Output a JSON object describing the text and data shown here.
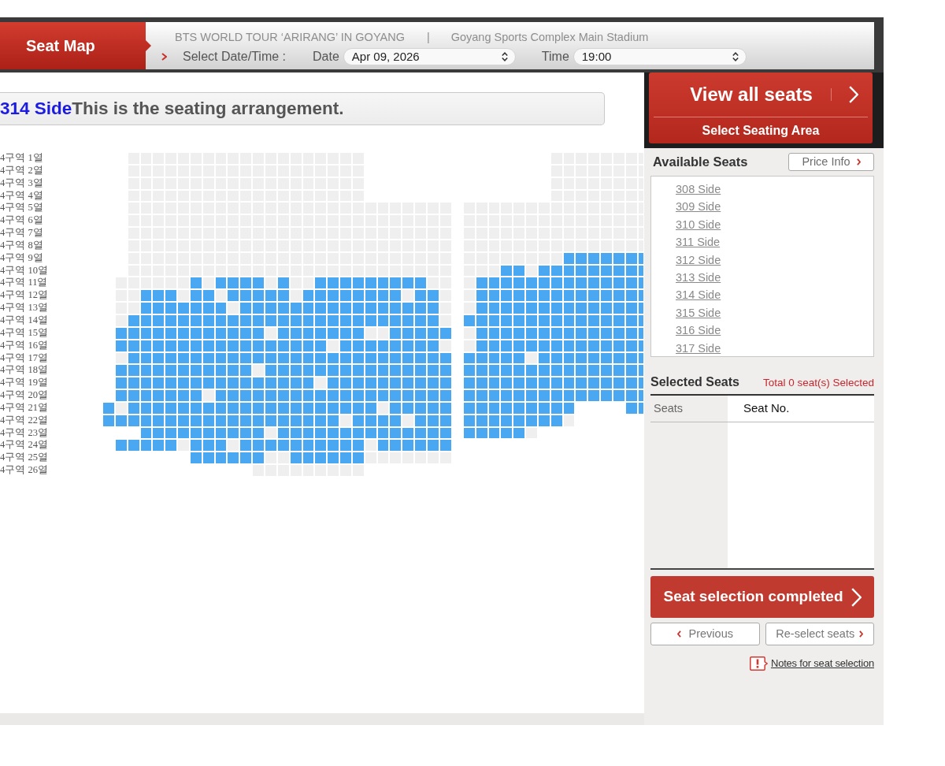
{
  "header": {
    "title": "Seat Map",
    "event": "BTS WORLD TOUR ‘ARIRANG’ IN GOYANG",
    "separator": "|",
    "venue": "Goyang Sports Complex Main Stadium",
    "select_label": "Select Date/Time :",
    "date": {
      "label": "Date",
      "value": "Apr 09, 2026"
    },
    "time": {
      "label": "Time",
      "value": "19:00"
    }
  },
  "seat_map": {
    "area": "314 Side",
    "caption": "This is the seating arrangement.",
    "rows": [
      {
        "label": "4구역 1열",
        "left": [
          {
            "kind": "gap"
          },
          {
            "kind": "gap"
          },
          false,
          false,
          false,
          false,
          false,
          false,
          false,
          false,
          false,
          false,
          false,
          false,
          false,
          false,
          false,
          false,
          false,
          false,
          false
        ],
        "right": [
          {
            "kind": "gap"
          },
          {
            "kind": "gap"
          },
          {
            "kind": "gap"
          },
          {
            "kind": "gap"
          },
          {
            "kind": "gap"
          },
          {
            "kind": "gap"
          },
          {
            "kind": "gap"
          },
          false,
          false,
          false,
          false,
          false,
          false,
          false,
          false
        ]
      },
      {
        "label": "4구역 2열",
        "left": [
          {
            "kind": "gap"
          },
          {
            "kind": "gap"
          },
          false,
          false,
          false,
          false,
          false,
          false,
          false,
          false,
          false,
          false,
          false,
          false,
          false,
          false,
          false,
          false,
          false,
          false,
          false
        ],
        "right": [
          {
            "kind": "gap"
          },
          {
            "kind": "gap"
          },
          {
            "kind": "gap"
          },
          {
            "kind": "gap"
          },
          {
            "kind": "gap"
          },
          {
            "kind": "gap"
          },
          {
            "kind": "gap"
          },
          false,
          false,
          false,
          false,
          false,
          false,
          false,
          false
        ]
      },
      {
        "label": "4구역 3열",
        "left": [
          {
            "kind": "gap"
          },
          {
            "kind": "gap"
          },
          false,
          false,
          false,
          false,
          false,
          false,
          false,
          false,
          false,
          false,
          false,
          false,
          false,
          false,
          false,
          false,
          false,
          false,
          false
        ],
        "right": [
          {
            "kind": "gap"
          },
          {
            "kind": "gap"
          },
          {
            "kind": "gap"
          },
          {
            "kind": "gap"
          },
          {
            "kind": "gap"
          },
          {
            "kind": "gap"
          },
          {
            "kind": "gap"
          },
          false,
          false,
          false,
          false,
          false,
          false,
          false,
          false
        ]
      },
      {
        "label": "4구역 4열",
        "left": [
          {
            "kind": "gap"
          },
          {
            "kind": "gap"
          },
          false,
          false,
          false,
          false,
          false,
          false,
          false,
          false,
          false,
          false,
          false,
          false,
          false,
          false,
          false,
          false,
          false,
          false,
          false
        ],
        "right": [
          {
            "kind": "gap"
          },
          {
            "kind": "gap"
          },
          {
            "kind": "gap"
          },
          {
            "kind": "gap"
          },
          {
            "kind": "gap"
          },
          {
            "kind": "gap"
          },
          {
            "kind": "gap"
          },
          false,
          false,
          false,
          false,
          false,
          false,
          false,
          false
        ]
      },
      {
        "label": "4구역 5열",
        "left": [
          {
            "kind": "gap"
          },
          {
            "kind": "gap"
          },
          false,
          false,
          false,
          false,
          false,
          false,
          false,
          false,
          false,
          false,
          false,
          false,
          false,
          false,
          false,
          false,
          false,
          false,
          false,
          false,
          false,
          false,
          false,
          false,
          false,
          false
        ],
        "right": [
          false,
          false,
          false,
          false,
          false,
          false,
          false,
          false,
          false,
          false,
          false,
          false,
          false,
          false,
          false
        ]
      },
      {
        "label": "4구역 6열",
        "left": [
          {
            "kind": "gap"
          },
          {
            "kind": "gap"
          },
          false,
          false,
          false,
          false,
          false,
          false,
          false,
          false,
          false,
          false,
          false,
          false,
          false,
          false,
          false,
          false,
          false,
          false,
          false,
          false,
          false,
          false,
          false,
          false,
          false,
          false
        ],
        "right": [
          false,
          false,
          false,
          false,
          false,
          false,
          false,
          false,
          false,
          false,
          false,
          false,
          false,
          false,
          false
        ]
      },
      {
        "label": "4구역 7열",
        "left": [
          {
            "kind": "gap"
          },
          {
            "kind": "gap"
          },
          false,
          false,
          false,
          false,
          false,
          false,
          false,
          false,
          false,
          false,
          false,
          false,
          false,
          false,
          false,
          false,
          false,
          false,
          false,
          false,
          false,
          false,
          false,
          false,
          false,
          false
        ],
        "right": [
          false,
          false,
          false,
          false,
          false,
          false,
          false,
          false,
          false,
          false,
          false,
          false,
          false,
          false,
          false
        ]
      },
      {
        "label": "4구역 8열",
        "left": [
          {
            "kind": "gap"
          },
          {
            "kind": "gap"
          },
          false,
          false,
          false,
          false,
          false,
          false,
          false,
          false,
          false,
          false,
          false,
          false,
          false,
          false,
          false,
          false,
          false,
          false,
          false,
          false,
          false,
          false,
          false,
          false,
          false,
          false
        ],
        "right": [
          false,
          false,
          false,
          false,
          false,
          false,
          false,
          false,
          false,
          false,
          false,
          false,
          false,
          false,
          false
        ]
      },
      {
        "label": "4구역 9열",
        "left": [
          {
            "kind": "gap"
          },
          {
            "kind": "gap"
          },
          false,
          false,
          false,
          false,
          false,
          false,
          false,
          false,
          false,
          false,
          false,
          false,
          false,
          false,
          false,
          false,
          false,
          false,
          false,
          false,
          false,
          false,
          false,
          false,
          false,
          false
        ],
        "right": [
          false,
          false,
          false,
          false,
          false,
          false,
          false,
          false,
          true,
          true,
          true,
          true,
          true,
          true,
          true
        ]
      },
      {
        "label": "4구역 10열",
        "left": [
          {
            "kind": "gap"
          },
          {
            "kind": "gap"
          },
          false,
          false,
          false,
          false,
          false,
          false,
          false,
          false,
          false,
          false,
          false,
          false,
          false,
          false,
          false,
          false,
          false,
          false,
          false,
          false,
          false,
          false,
          false,
          false,
          false,
          false
        ],
        "right": [
          false,
          false,
          false,
          true,
          true,
          false,
          true,
          true,
          true,
          true,
          true,
          true,
          true,
          true,
          true
        ]
      },
      {
        "label": "4구역 11열",
        "left": [
          {
            "kind": "gap"
          },
          false,
          false,
          false,
          false,
          false,
          false,
          true,
          false,
          true,
          true,
          true,
          true,
          false,
          true,
          false,
          false,
          true,
          true,
          true,
          true,
          true,
          true,
          true,
          true,
          true,
          false,
          false
        ],
        "right": [
          false,
          true,
          true,
          true,
          true,
          true,
          true,
          true,
          true,
          true,
          true,
          true,
          true,
          true,
          true
        ]
      },
      {
        "label": "4구역 12열",
        "left": [
          {
            "kind": "gap"
          },
          false,
          false,
          true,
          true,
          true,
          false,
          true,
          true,
          false,
          true,
          true,
          true,
          true,
          true,
          false,
          true,
          true,
          true,
          true,
          true,
          true,
          true,
          true,
          false,
          true,
          true,
          false
        ],
        "right": [
          false,
          true,
          true,
          true,
          true,
          true,
          true,
          true,
          true,
          true,
          true,
          true,
          true,
          true,
          true
        ]
      },
      {
        "label": "4구역 13열",
        "left": [
          {
            "kind": "gap"
          },
          false,
          false,
          true,
          true,
          true,
          true,
          true,
          true,
          true,
          false,
          true,
          true,
          true,
          true,
          true,
          true,
          true,
          true,
          true,
          true,
          true,
          true,
          true,
          true,
          true,
          true,
          false
        ],
        "right": [
          false,
          true,
          true,
          true,
          true,
          true,
          true,
          true,
          true,
          true,
          true,
          true,
          true,
          true,
          true
        ]
      },
      {
        "label": "4구역 14열",
        "left": [
          {
            "kind": "gap"
          },
          false,
          true,
          true,
          true,
          true,
          true,
          true,
          true,
          true,
          true,
          true,
          true,
          true,
          true,
          true,
          true,
          true,
          true,
          true,
          true,
          true,
          true,
          true,
          true,
          true,
          true,
          false
        ],
        "right": [
          true,
          true,
          true,
          true,
          true,
          true,
          true,
          true,
          true,
          true,
          true,
          true,
          true,
          true,
          true
        ]
      },
      {
        "label": "4구역 15열",
        "left": [
          {
            "kind": "gap"
          },
          true,
          true,
          true,
          true,
          true,
          true,
          true,
          true,
          true,
          true,
          true,
          true,
          false,
          true,
          true,
          true,
          true,
          true,
          true,
          true,
          false,
          false,
          true,
          true,
          true,
          true,
          true
        ],
        "right": [
          false,
          true,
          true,
          true,
          true,
          true,
          true,
          true,
          true,
          true,
          true,
          true,
          true,
          true,
          true
        ]
      },
      {
        "label": "4구역 16열",
        "left": [
          {
            "kind": "gap"
          },
          true,
          true,
          true,
          true,
          true,
          true,
          true,
          true,
          true,
          true,
          true,
          true,
          true,
          true,
          true,
          true,
          true,
          false,
          true,
          true,
          true,
          true,
          true,
          true,
          true,
          true,
          false
        ],
        "right": [
          false,
          true,
          true,
          true,
          true,
          true,
          true,
          true,
          true,
          true,
          true,
          true,
          true,
          true,
          true
        ]
      },
      {
        "label": "4구역 17열",
        "left": [
          {
            "kind": "gap"
          },
          false,
          true,
          true,
          true,
          true,
          true,
          true,
          true,
          true,
          true,
          true,
          true,
          true,
          true,
          true,
          true,
          true,
          true,
          true,
          true,
          true,
          true,
          true,
          true,
          true,
          true,
          true
        ],
        "right": [
          true,
          true,
          true,
          true,
          true,
          false,
          true,
          true,
          true,
          true,
          true,
          true,
          true,
          true,
          true
        ]
      },
      {
        "label": "4구역 18열",
        "left": [
          {
            "kind": "gap"
          },
          true,
          true,
          true,
          true,
          true,
          true,
          true,
          true,
          true,
          true,
          true,
          false,
          true,
          true,
          true,
          true,
          true,
          true,
          true,
          true,
          true,
          true,
          true,
          true,
          true,
          true,
          true
        ],
        "right": [
          true,
          true,
          true,
          true,
          true,
          true,
          true,
          true,
          true,
          true,
          true,
          true,
          true,
          true,
          true
        ]
      },
      {
        "label": "4구역 19열",
        "left": [
          {
            "kind": "gap"
          },
          true,
          true,
          true,
          true,
          true,
          true,
          true,
          true,
          true,
          true,
          true,
          true,
          true,
          true,
          true,
          true,
          false,
          true,
          true,
          true,
          true,
          true,
          true,
          true,
          true,
          true,
          true
        ],
        "right": [
          true,
          true,
          true,
          true,
          true,
          true,
          true,
          true,
          true,
          true,
          true,
          true,
          true,
          true,
          true
        ]
      },
      {
        "label": "4구역 20열",
        "left": [
          {
            "kind": "gap"
          },
          true,
          true,
          true,
          true,
          true,
          true,
          true,
          false,
          true,
          true,
          true,
          true,
          true,
          true,
          true,
          true,
          true,
          true,
          true,
          true,
          true,
          true,
          true,
          true,
          true,
          true,
          true
        ],
        "right": [
          true,
          true,
          true,
          true,
          true,
          true,
          true,
          true,
          true,
          true,
          true,
          true,
          true,
          true,
          true
        ]
      },
      {
        "label": "4구역 21열",
        "left": [
          true,
          false,
          true,
          true,
          true,
          true,
          true,
          true,
          true,
          true,
          true,
          true,
          true,
          true,
          true,
          true,
          true,
          true,
          true,
          true,
          true,
          true,
          false,
          true,
          true,
          true,
          true,
          true
        ],
        "right": [
          true,
          true,
          true,
          true,
          true,
          true,
          true,
          true,
          true,
          {
            "kind": "gap"
          },
          {
            "kind": "gap"
          },
          {
            "kind": "gap"
          },
          {
            "kind": "gap"
          },
          true,
          true
        ]
      },
      {
        "label": "4구역 22열",
        "left": [
          true,
          true,
          true,
          true,
          true,
          true,
          true,
          true,
          true,
          true,
          true,
          true,
          true,
          true,
          true,
          true,
          true,
          true,
          true,
          false,
          true,
          true,
          true,
          true,
          false,
          true,
          true,
          true
        ],
        "right": [
          true,
          true,
          true,
          true,
          true,
          true,
          true,
          true,
          false
        ]
      },
      {
        "label": "4구역 23열",
        "left": [
          {
            "kind": "gap"
          },
          {
            "kind": "gap"
          },
          {
            "kind": "gap"
          },
          true,
          true,
          true,
          true,
          true,
          true,
          true,
          true,
          true,
          true,
          false,
          true,
          true,
          true,
          true,
          true,
          true,
          true,
          true,
          true,
          true,
          true,
          true,
          true,
          true
        ],
        "right": [
          true,
          true,
          true,
          true,
          true,
          false
        ]
      },
      {
        "label": "4구역 24열",
        "left": [
          {
            "kind": "gap"
          },
          true,
          true,
          true,
          true,
          true,
          false,
          true,
          true,
          true,
          false,
          true,
          true,
          true,
          true,
          true,
          true,
          true,
          true,
          true,
          true,
          false,
          true,
          true,
          true,
          true,
          true,
          true
        ]
      },
      {
        "label": "4구역 25열",
        "left": [
          {
            "kind": "gap"
          },
          {
            "kind": "gap"
          },
          {
            "kind": "gap"
          },
          {
            "kind": "gap"
          },
          {
            "kind": "gap"
          },
          {
            "kind": "gap"
          },
          {
            "kind": "gap"
          },
          true,
          true,
          true,
          true,
          true,
          true,
          false,
          false,
          true,
          true,
          true,
          true,
          true,
          true,
          false,
          false,
          false,
          false,
          false,
          false,
          false
        ]
      },
      {
        "label": "4구역 26열",
        "left": [
          {
            "kind": "gap"
          },
          {
            "kind": "gap"
          },
          {
            "kind": "gap"
          },
          {
            "kind": "gap"
          },
          {
            "kind": "gap"
          },
          {
            "kind": "gap"
          },
          {
            "kind": "gap"
          },
          {
            "kind": "gap"
          },
          {
            "kind": "gap"
          },
          {
            "kind": "gap"
          },
          {
            "kind": "gap"
          },
          {
            "kind": "gap"
          },
          false,
          false,
          false,
          false,
          false,
          false,
          false,
          false,
          false
        ]
      }
    ]
  },
  "side": {
    "view_all": "View all seats",
    "select_area": "Select Seating Area",
    "available_title": "Available Seats",
    "price_button": "Price Info",
    "areas": [
      "308 Side",
      "309 Side",
      "310 Side",
      "311 Side",
      "312 Side",
      "313 Side",
      "314 Side",
      "315 Side",
      "316 Side",
      "317 Side"
    ],
    "selected_title": "Selected Seats",
    "total": "Total 0 seat(s) Selected",
    "columns": [
      "Seats",
      "Seat No."
    ],
    "complete_button": "Seat selection completed",
    "previous_button": "Previous",
    "reselect_button": "Re-select seats",
    "notes_link": "Notes for seat selection"
  }
}
